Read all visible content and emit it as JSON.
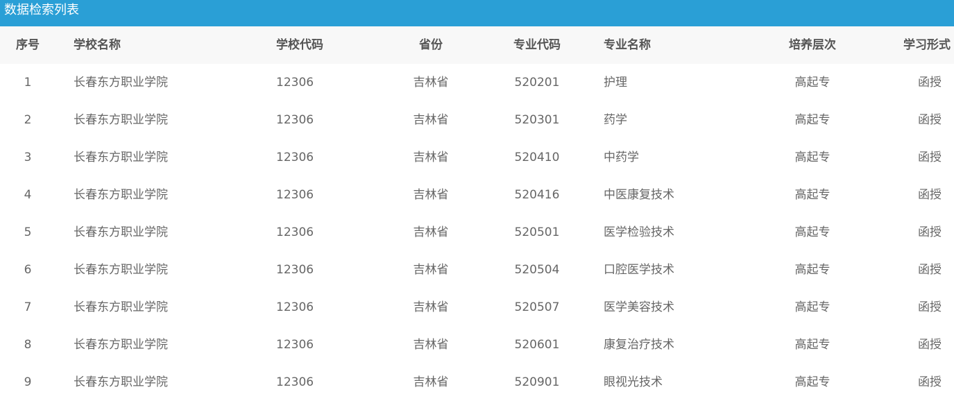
{
  "panel": {
    "title": "数据检索列表"
  },
  "table": {
    "columns": [
      "序号",
      "学校名称",
      "学校代码",
      "省份",
      "专业代码",
      "专业名称",
      "培养层次",
      "学习形式"
    ],
    "rows": [
      [
        "1",
        "长春东方职业学院",
        "12306",
        "吉林省",
        "520201",
        "护理",
        "高起专",
        "函授"
      ],
      [
        "2",
        "长春东方职业学院",
        "12306",
        "吉林省",
        "520301",
        "药学",
        "高起专",
        "函授"
      ],
      [
        "3",
        "长春东方职业学院",
        "12306",
        "吉林省",
        "520410",
        "中药学",
        "高起专",
        "函授"
      ],
      [
        "4",
        "长春东方职业学院",
        "12306",
        "吉林省",
        "520416",
        "中医康复技术",
        "高起专",
        "函授"
      ],
      [
        "5",
        "长春东方职业学院",
        "12306",
        "吉林省",
        "520501",
        "医学检验技术",
        "高起专",
        "函授"
      ],
      [
        "6",
        "长春东方职业学院",
        "12306",
        "吉林省",
        "520504",
        "口腔医学技术",
        "高起专",
        "函授"
      ],
      [
        "7",
        "长春东方职业学院",
        "12306",
        "吉林省",
        "520507",
        "医学美容技术",
        "高起专",
        "函授"
      ],
      [
        "8",
        "长春东方职业学院",
        "12306",
        "吉林省",
        "520601",
        "康复治疗技术",
        "高起专",
        "函授"
      ],
      [
        "9",
        "长春东方职业学院",
        "12306",
        "吉林省",
        "520901",
        "眼视光技术",
        "高起专",
        "函授"
      ]
    ]
  },
  "colors": {
    "header_bg": "#2a9fd6",
    "table_head_bg": "#f8f8f8",
    "text": "#666666"
  }
}
